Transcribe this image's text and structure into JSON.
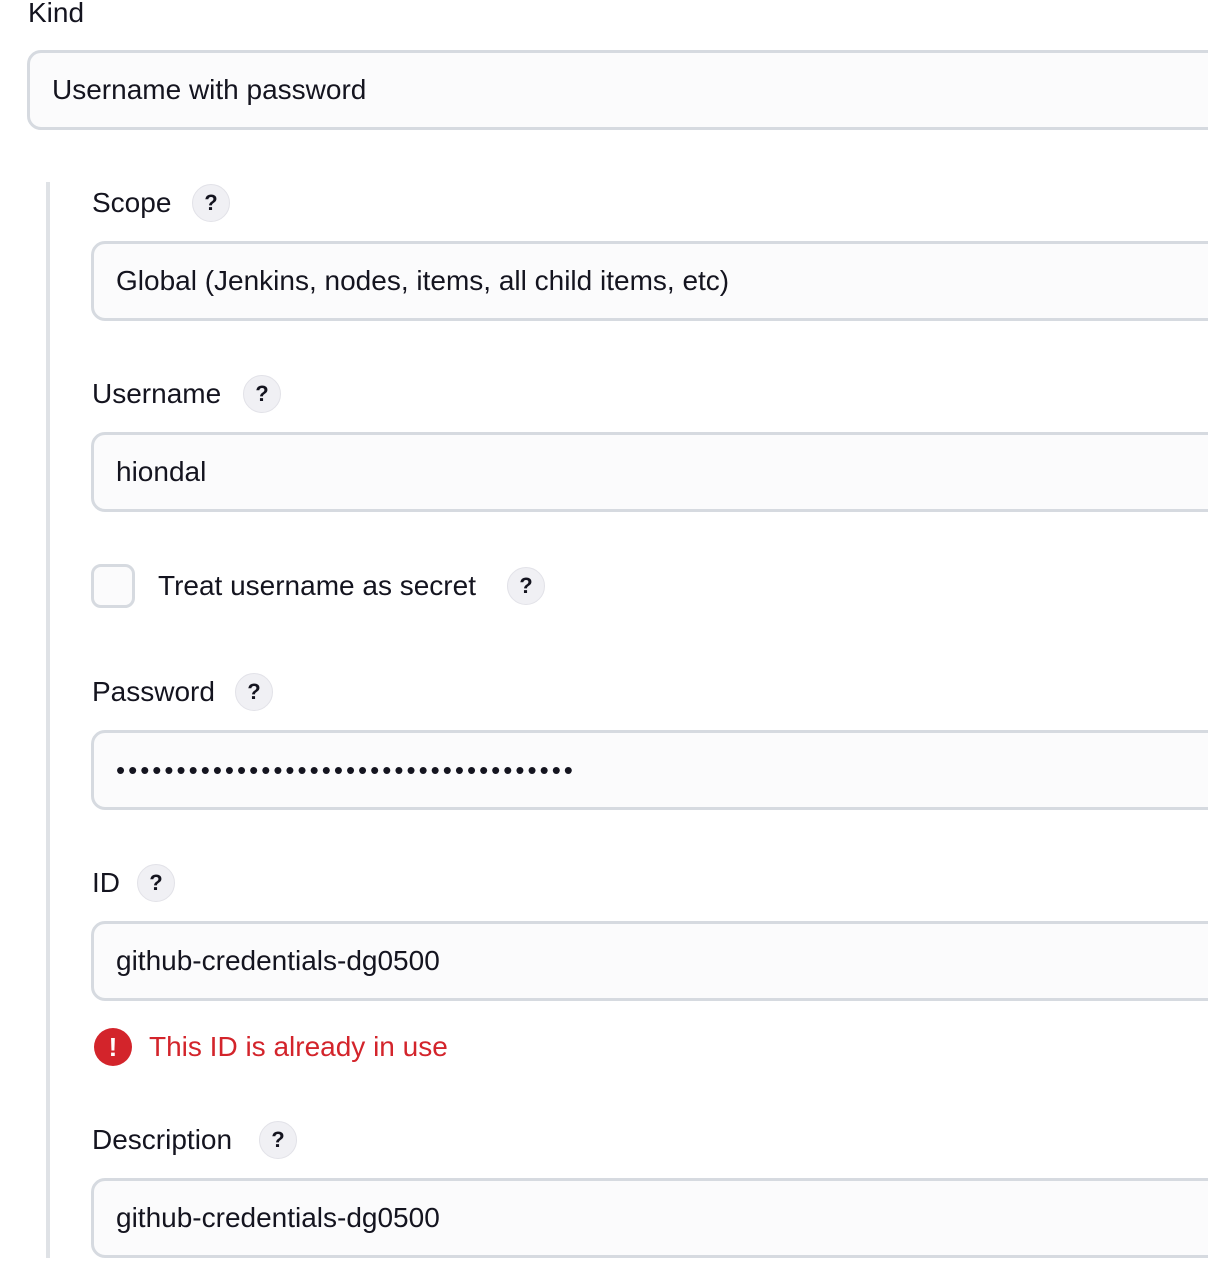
{
  "kind": {
    "label": "Kind",
    "value": "Username with password"
  },
  "scope": {
    "label": "Scope",
    "help": "?",
    "value": "Global (Jenkins, nodes, items, all child items, etc)"
  },
  "username": {
    "label": "Username",
    "help": "?",
    "value": "hiondal"
  },
  "treat_username_secret": {
    "label": "Treat username as secret",
    "help": "?",
    "checked": false
  },
  "password": {
    "label": "Password",
    "help": "?",
    "masked_value": "••••••••••••••••••••••••••••••••••••••"
  },
  "id": {
    "label": "ID",
    "help": "?",
    "value": "github-credentials-dg0500",
    "error_icon": "!",
    "error": "This ID is already in use"
  },
  "description": {
    "label": "Description",
    "help": "?",
    "value": "github-credentials-dg0500"
  },
  "colors": {
    "error": "#d3242b",
    "field_border": "#d6dae0",
    "field_background": "#fbfbfc",
    "help_background": "#f0f0f4"
  }
}
